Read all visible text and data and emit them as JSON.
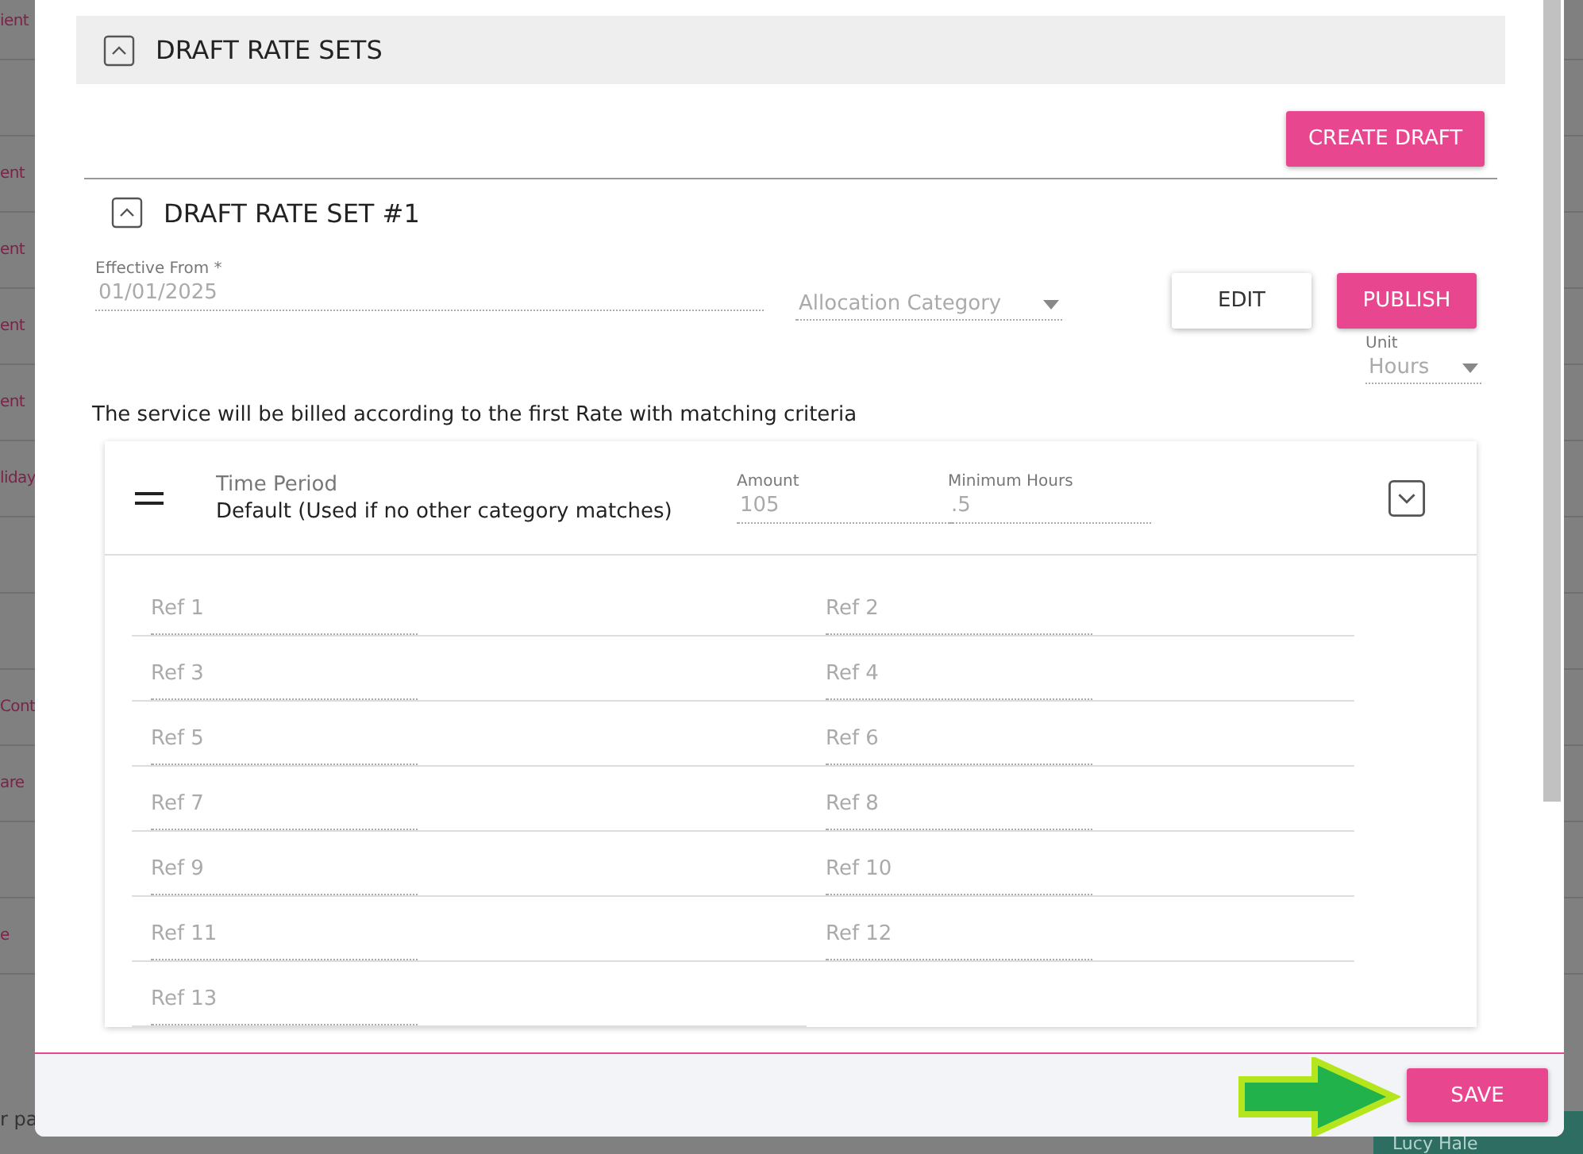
{
  "background": {
    "rows": [
      {
        "kind": "text",
        "text": "ient"
      },
      {
        "kind": "blank"
      },
      {
        "kind": "text",
        "text": "ent"
      },
      {
        "kind": "text",
        "text": "ent"
      },
      {
        "kind": "text",
        "text": "ent"
      },
      {
        "kind": "text",
        "text": "ent"
      },
      {
        "kind": "text",
        "text": "liday"
      },
      {
        "kind": "blank"
      },
      {
        "kind": "blank"
      },
      {
        "kind": "text",
        "text": "Cont"
      },
      {
        "kind": "text",
        "text": "are"
      },
      {
        "kind": "blank"
      },
      {
        "kind": "text",
        "text": "e"
      }
    ],
    "footer_fragment": "r pa",
    "user_name": "Lucy Hale"
  },
  "modal": {
    "section": {
      "title": "DRAFT RATE SETS",
      "expanded": true
    },
    "create_button": "CREATE DRAFT",
    "rate_set": {
      "title": "DRAFT RATE SET #1",
      "expanded": true,
      "effective_from": {
        "label": "Effective From *",
        "value": "01/01/2025"
      },
      "allocation_category": {
        "placeholder": "Allocation Category"
      },
      "buttons": [
        {
          "label": "EDIT",
          "kind": "secondary"
        },
        {
          "label": "PUBLISH",
          "kind": "primary"
        }
      ],
      "unit": {
        "label": "Unit",
        "value": "Hours"
      },
      "note": "The service will be billed according to the first Rate with matching criteria",
      "rates": [
        {
          "title": "Time Period",
          "subtitle": "Default (Used if no other category matches)",
          "amount": {
            "label": "Amount",
            "value": "105"
          },
          "minimum": {
            "label": "Minimum Hours",
            "value": ".5"
          },
          "expanded": false,
          "refs": [
            {
              "placeholder": "Ref 1"
            },
            {
              "placeholder": "Ref 2"
            },
            {
              "placeholder": "Ref 3"
            },
            {
              "placeholder": "Ref 4"
            },
            {
              "placeholder": "Ref 5"
            },
            {
              "placeholder": "Ref 6"
            },
            {
              "placeholder": "Ref 7"
            },
            {
              "placeholder": "Ref 8"
            },
            {
              "placeholder": "Ref 9"
            },
            {
              "placeholder": "Ref 10"
            },
            {
              "placeholder": "Ref 11"
            },
            {
              "placeholder": "Ref 12"
            },
            {
              "placeholder": "Ref 13"
            }
          ]
        }
      ]
    },
    "save_button": "SAVE"
  }
}
